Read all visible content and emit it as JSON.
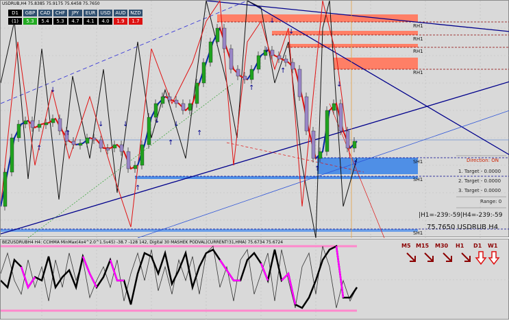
{
  "main_header": "USDRUB,H4  75.8385 75.9175 75.6458 75.7650",
  "strength_table": {
    "row_label_top": "D1",
    "row_label_bottom": "(1)",
    "currencies": [
      "GBP",
      "CAD",
      "CHF",
      "JPY",
      "EUR",
      "USD",
      "AUD",
      "NZD"
    ],
    "values": [
      "5.3",
      "5.4",
      "5.3",
      "4.7",
      "4.1",
      "4.0",
      "1.9",
      "1.7"
    ],
    "value_styles": [
      "green",
      "plain",
      "plain",
      "plain",
      "plain",
      "plain",
      "red",
      "red"
    ]
  },
  "levels": [
    {
      "label": "RH1"
    },
    {
      "label": "RH1"
    },
    {
      "label": "RH1"
    },
    {
      "label": "RH1"
    },
    {
      "label": "SH1"
    },
    {
      "label": "SH1"
    },
    {
      "label": "SH1"
    }
  ],
  "info_panel": {
    "direction": "Direction: ON",
    "targets": [
      "1. Target - 0.0000",
      "2. Target - 0.0000",
      "3. Target - 0.0000"
    ],
    "range": "Range: 0",
    "hl_text": "|H1=-239:-59|H4=-239:-59",
    "price_text": "75.7650 USDRUB H4"
  },
  "sub_header": "BEZUSDRUBH4  H4: CCIHMA MinMax(4x4^2.0^1.5v45) -38.7 -128 142, Digital 30 MASHEK PODVAL(CURRENT!31,HMA) 75.6734 75.6724",
  "timeframes": [
    "M5",
    "M15",
    "M30",
    "H1",
    "D1",
    "W1"
  ],
  "timeframe_arrows": [
    "down-right",
    "down-right",
    "down-right",
    "down-right",
    "down",
    "down"
  ],
  "colors": {
    "chart_bg": "#d9d9d9",
    "bull_candle": "#1fa21f",
    "bear_candle": "#9a86c8",
    "resistance_zone": "#ff7f66",
    "support_zone": "#4f8fe6",
    "trend_navy": "#00008b",
    "hma_red": "#e01010",
    "hma_blue": "#0030b0",
    "osc_magenta": "#ff00ff",
    "osc_band": "#ff88cc"
  },
  "icons": {
    "arrow_up": "arrow-up-icon",
    "arrow_down": "arrow-down-icon",
    "tf_arrow": "tf-arrow-icon"
  }
}
